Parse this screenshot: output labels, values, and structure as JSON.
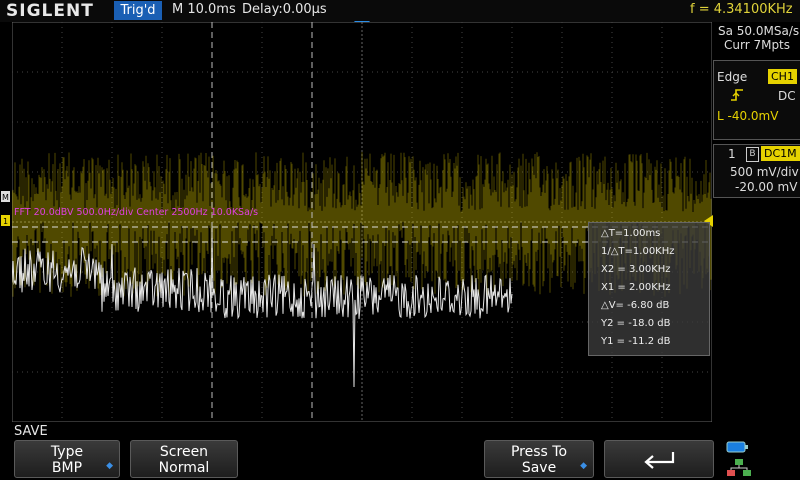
{
  "header": {
    "logo": "SIGLENT",
    "trig_status": "Trig'd",
    "timebase": "M 10.0ms",
    "delay": "Delay:0.00µs",
    "frequency": "f = 4.34100KHz"
  },
  "acquisition": {
    "sample_rate": "Sa 50.0MSa/s",
    "memory": "Curr 7Mpts"
  },
  "trigger": {
    "type": "Edge",
    "source": "CH1",
    "slope_icon": "rising-edge-icon",
    "coupling": "DC",
    "level": "L  -40.0mV"
  },
  "channel": {
    "number": "1",
    "bw_icon": "bandwidth-limit-icon",
    "coupling": "DC1M",
    "scale": "500 mV/div",
    "offset": "-20.00 mV"
  },
  "fft": {
    "label": "FFT  20.0dBV  500.0Hz/div  Center 2500Hz  10.0KSa/s"
  },
  "cursor": {
    "delta_t": "△T=1.00ms",
    "inv_delta_t": "1/△T=1.00KHz",
    "x2": "X2 = 3.00KHz",
    "x1": "X1 = 2.00KHz",
    "delta_v": "△V= -6.80 dB",
    "y2": "Y2 = -18.0 dB",
    "y1": "Y1 = -11.2 dB"
  },
  "menu": {
    "title": "SAVE",
    "type_label": "Type",
    "type_value": "BMP",
    "screen_label": "Screen",
    "screen_value": "Normal",
    "press_label": "Press To",
    "press_value": "Save",
    "back_icon": "return-arrow-icon"
  },
  "colors": {
    "ch1": "#e6d200",
    "fft": "#e6e6e6",
    "math_label": "#e040e0",
    "accent": "#1a5fb4"
  }
}
